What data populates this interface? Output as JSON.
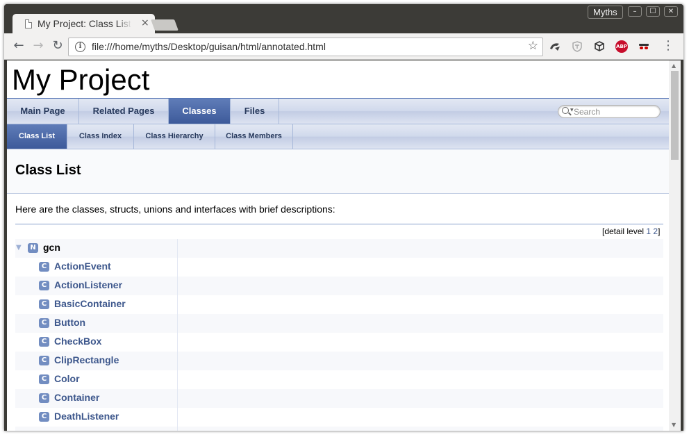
{
  "window": {
    "profile_name": "Myths",
    "controls": {
      "minimize": "–",
      "maximize": "☐",
      "close": "✕"
    }
  },
  "tab": {
    "title": "My Project: Class List",
    "close_glyph": "×",
    "icon": "page-icon"
  },
  "toolbar": {
    "back_glyph": "←",
    "forward_glyph": "→",
    "reload_glyph": "↻",
    "url": "file:///home/myths/Desktop/guisan/html/annotated.html",
    "info_glyph": "i",
    "bookmark_glyph": "☆",
    "extensions": [
      "extension-1-icon",
      "shield-extension-icon",
      "cube-extension-icon",
      "adblock-plus-icon",
      "incognito-extension-icon"
    ],
    "abp_label": "ABP",
    "menu_glyph": "⋮"
  },
  "page": {
    "project_title": "My Project",
    "nav_tabs": [
      {
        "label": "Main Page",
        "active": false
      },
      {
        "label": "Related Pages",
        "active": false
      },
      {
        "label": "Classes",
        "active": true
      },
      {
        "label": "Files",
        "active": false
      }
    ],
    "search_placeholder": "Search",
    "sub_tabs": [
      {
        "label": "Class List",
        "active": true
      },
      {
        "label": "Class Index",
        "active": false
      },
      {
        "label": "Class Hierarchy",
        "active": false
      },
      {
        "label": "Class Members",
        "active": false
      }
    ],
    "heading": "Class List",
    "intro": "Here are the classes, structs, unions and interfaces with brief descriptions:",
    "detail_level": {
      "label": "[detail level ",
      "levels": [
        "1",
        "2"
      ],
      "close": "]"
    },
    "namespace": {
      "badge": "N",
      "name": "gcn",
      "expanded_glyph": "▼"
    },
    "class_badge": "C",
    "classes": [
      "ActionEvent",
      "ActionListener",
      "BasicContainer",
      "Button",
      "CheckBox",
      "ClipRectangle",
      "Color",
      "Container",
      "DeathListener"
    ]
  },
  "colors": {
    "nav_active": "#3d5a9a",
    "link": "#3d578c",
    "badge": "#728dc1"
  }
}
